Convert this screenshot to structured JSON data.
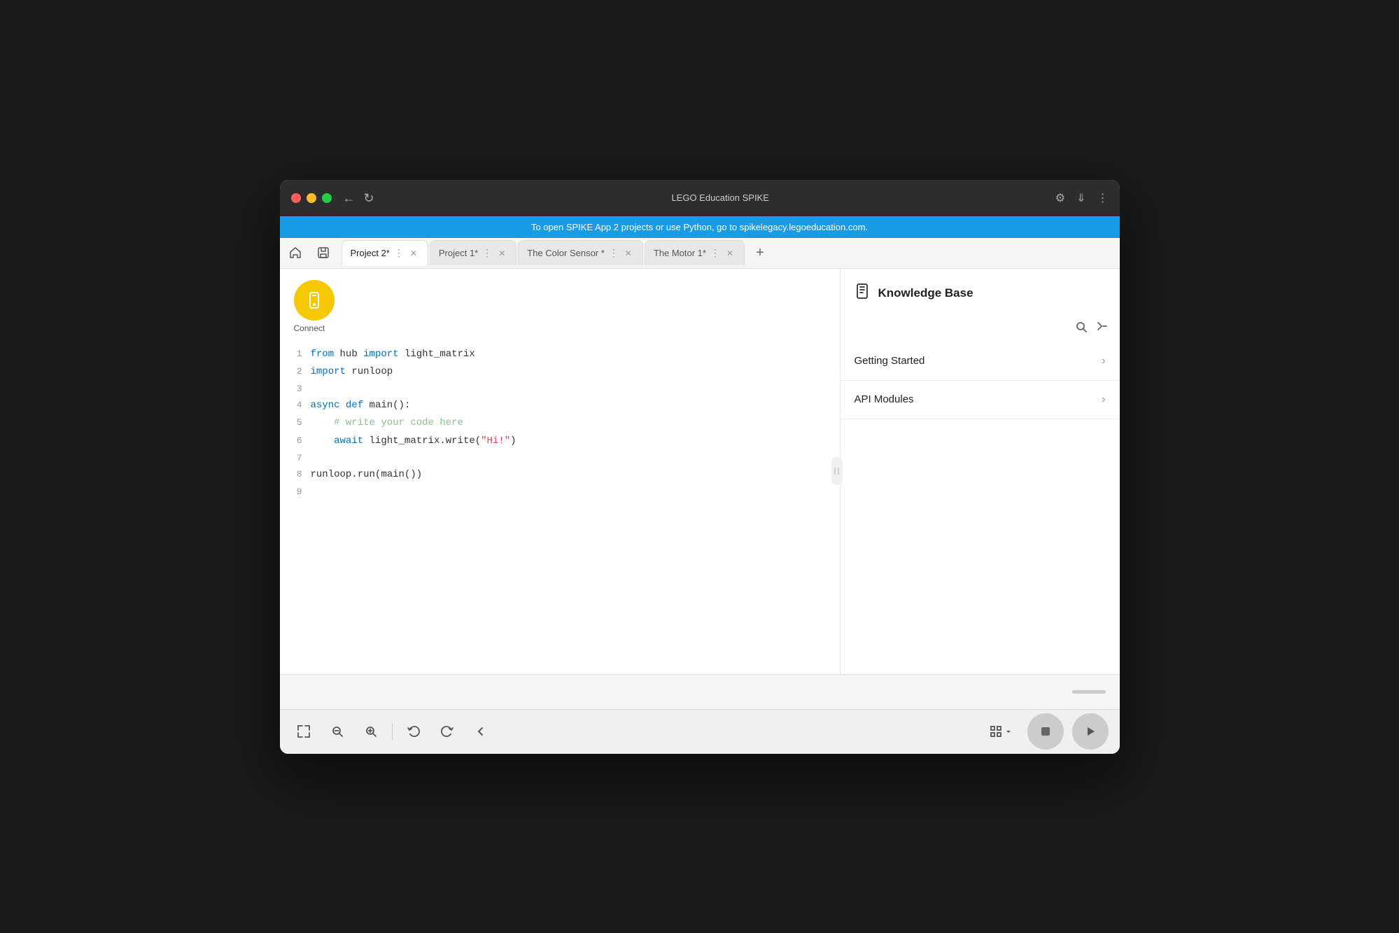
{
  "browser": {
    "title": "LEGO Education SPIKE",
    "banner": "To open SPIKE App 2 projects or use Python, go to spikelegacy.legoeducation.com."
  },
  "tabs": [
    {
      "id": "project2",
      "label": "Project 2*",
      "active": true
    },
    {
      "id": "project1",
      "label": "Project 1*",
      "active": false
    },
    {
      "id": "color-sensor",
      "label": "The Color Sensor *",
      "active": false
    },
    {
      "id": "motor",
      "label": "The Motor 1*",
      "active": false
    }
  ],
  "connect": {
    "label": "Connect"
  },
  "code_lines": [
    {
      "num": "1",
      "content": "from hub import light_matrix",
      "tokens": [
        {
          "text": "from",
          "class": "kw-from"
        },
        {
          "text": " hub ",
          "class": "identifier"
        },
        {
          "text": "import",
          "class": "kw-import"
        },
        {
          "text": " light_matrix",
          "class": "identifier"
        }
      ]
    },
    {
      "num": "2",
      "content": "import runloop",
      "tokens": [
        {
          "text": "import",
          "class": "kw-import"
        },
        {
          "text": " runloop",
          "class": "identifier"
        }
      ]
    },
    {
      "num": "3",
      "content": ""
    },
    {
      "num": "4",
      "content": "async def main():",
      "tokens": [
        {
          "text": "async",
          "class": "kw-async"
        },
        {
          "text": " ",
          "class": ""
        },
        {
          "text": "def",
          "class": "kw-def"
        },
        {
          "text": " main():",
          "class": "identifier"
        }
      ]
    },
    {
      "num": "5",
      "content": "    # write your code here",
      "tokens": [
        {
          "text": "    # write your code here",
          "class": "comment"
        }
      ]
    },
    {
      "num": "6",
      "content": "    await light_matrix.write(\"Hi!\")",
      "tokens": [
        {
          "text": "    ",
          "class": ""
        },
        {
          "text": "await",
          "class": "kw-await"
        },
        {
          "text": " light_matrix.write(",
          "class": "identifier"
        },
        {
          "text": "\"Hi!\"",
          "class": "string"
        },
        {
          "text": ")",
          "class": "identifier"
        }
      ]
    },
    {
      "num": "7",
      "content": ""
    },
    {
      "num": "8",
      "content": "runloop.run(main())",
      "tokens": [
        {
          "text": "runloop.run(main())",
          "class": "identifier"
        }
      ]
    },
    {
      "num": "9",
      "content": ""
    }
  ],
  "knowledge_base": {
    "title": "Knowledge Base",
    "items": [
      {
        "label": "Getting Started"
      },
      {
        "label": "API Modules"
      }
    ]
  },
  "toolbar": {
    "fullscreen_label": "⤢",
    "zoom_out_label": "−",
    "zoom_in_label": "+",
    "undo_label": "↩",
    "redo_label": "↪",
    "collapse_label": "‹"
  }
}
